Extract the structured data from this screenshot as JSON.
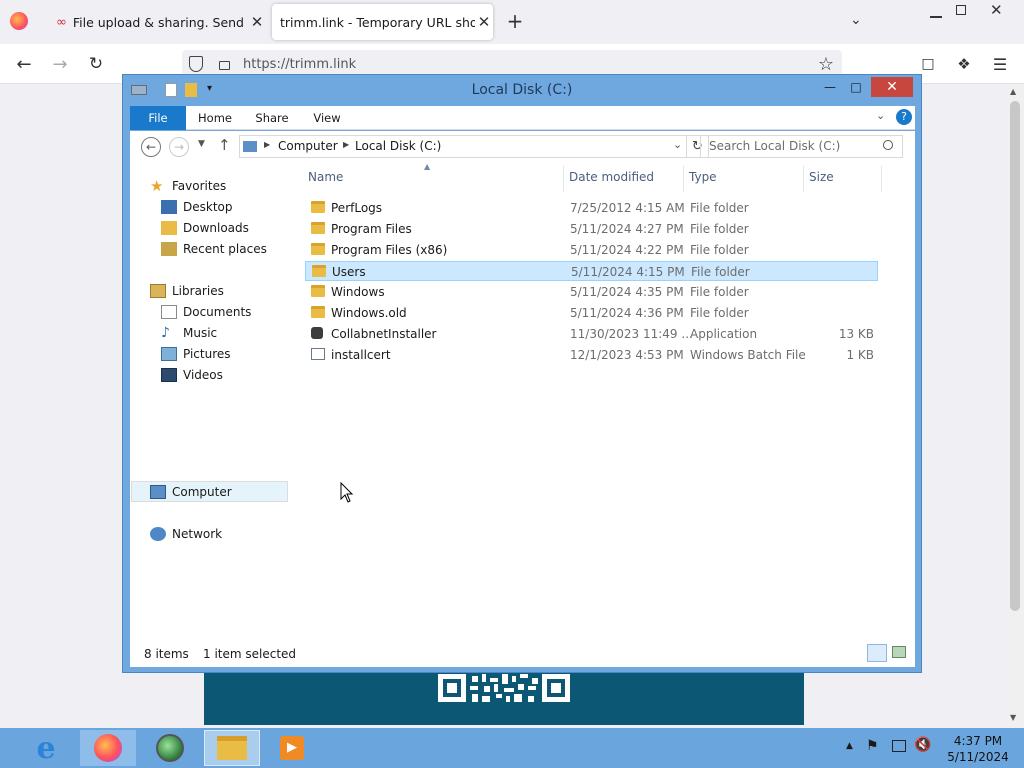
{
  "browser": {
    "tabs": [
      {
        "title": "File upload & sharing. Send large files",
        "active": false
      },
      {
        "title": "trimm.link - Temporary URL shortener",
        "active": true
      }
    ],
    "new_tab_glyph": "+",
    "tab_close_glyph": "✕",
    "url": "https://trimm.link"
  },
  "explorer": {
    "title": "Local Disk (C:)",
    "ribbon_tabs": [
      "File",
      "Home",
      "Share",
      "View"
    ],
    "breadcrumb": [
      "Computer",
      "Local Disk (C:)"
    ],
    "search_placeholder": "Search Local Disk (C:)",
    "nav": {
      "favorites_label": "Favorites",
      "favorites": [
        "Desktop",
        "Downloads",
        "Recent places"
      ],
      "libraries_label": "Libraries",
      "libraries": [
        "Documents",
        "Music",
        "Pictures",
        "Videos"
      ],
      "computer_label": "Computer",
      "network_label": "Network"
    },
    "columns": [
      "Name",
      "Date modified",
      "Type",
      "Size"
    ],
    "files": [
      {
        "name": "PerfLogs",
        "date": "7/25/2012 4:15 AM",
        "type": "File folder",
        "size": "",
        "icon": "folder-icon",
        "selected": false
      },
      {
        "name": "Program Files",
        "date": "5/11/2024 4:27 PM",
        "type": "File folder",
        "size": "",
        "icon": "folder-icon",
        "selected": false
      },
      {
        "name": "Program Files (x86)",
        "date": "5/11/2024 4:22 PM",
        "type": "File folder",
        "size": "",
        "icon": "folder-icon",
        "selected": false
      },
      {
        "name": "Users",
        "date": "5/11/2024 4:15 PM",
        "type": "File folder",
        "size": "",
        "icon": "folder-icon",
        "selected": true
      },
      {
        "name": "Windows",
        "date": "5/11/2024 4:35 PM",
        "type": "File folder",
        "size": "",
        "icon": "folder-icon",
        "selected": false
      },
      {
        "name": "Windows.old",
        "date": "5/11/2024 4:36 PM",
        "type": "File folder",
        "size": "",
        "icon": "folder-icon",
        "selected": false
      },
      {
        "name": "CollabnetInstaller",
        "date": "11/30/2023 11:49 ...",
        "type": "Application",
        "size": "13 KB",
        "icon": "application-icon",
        "selected": false
      },
      {
        "name": "installcert",
        "date": "12/1/2023 4:53 PM",
        "type": "Windows Batch File",
        "size": "1 KB",
        "icon": "batch-file-icon",
        "selected": false
      }
    ],
    "status": {
      "items": "8 items",
      "selected": "1 item selected"
    }
  },
  "taskbar": {
    "apps": [
      "internet-explorer-icon",
      "firefox-icon",
      "network-globe-icon",
      "file-explorer-icon",
      "media-player-icon"
    ],
    "time": "4:37 PM",
    "date": "5/11/2024"
  }
}
